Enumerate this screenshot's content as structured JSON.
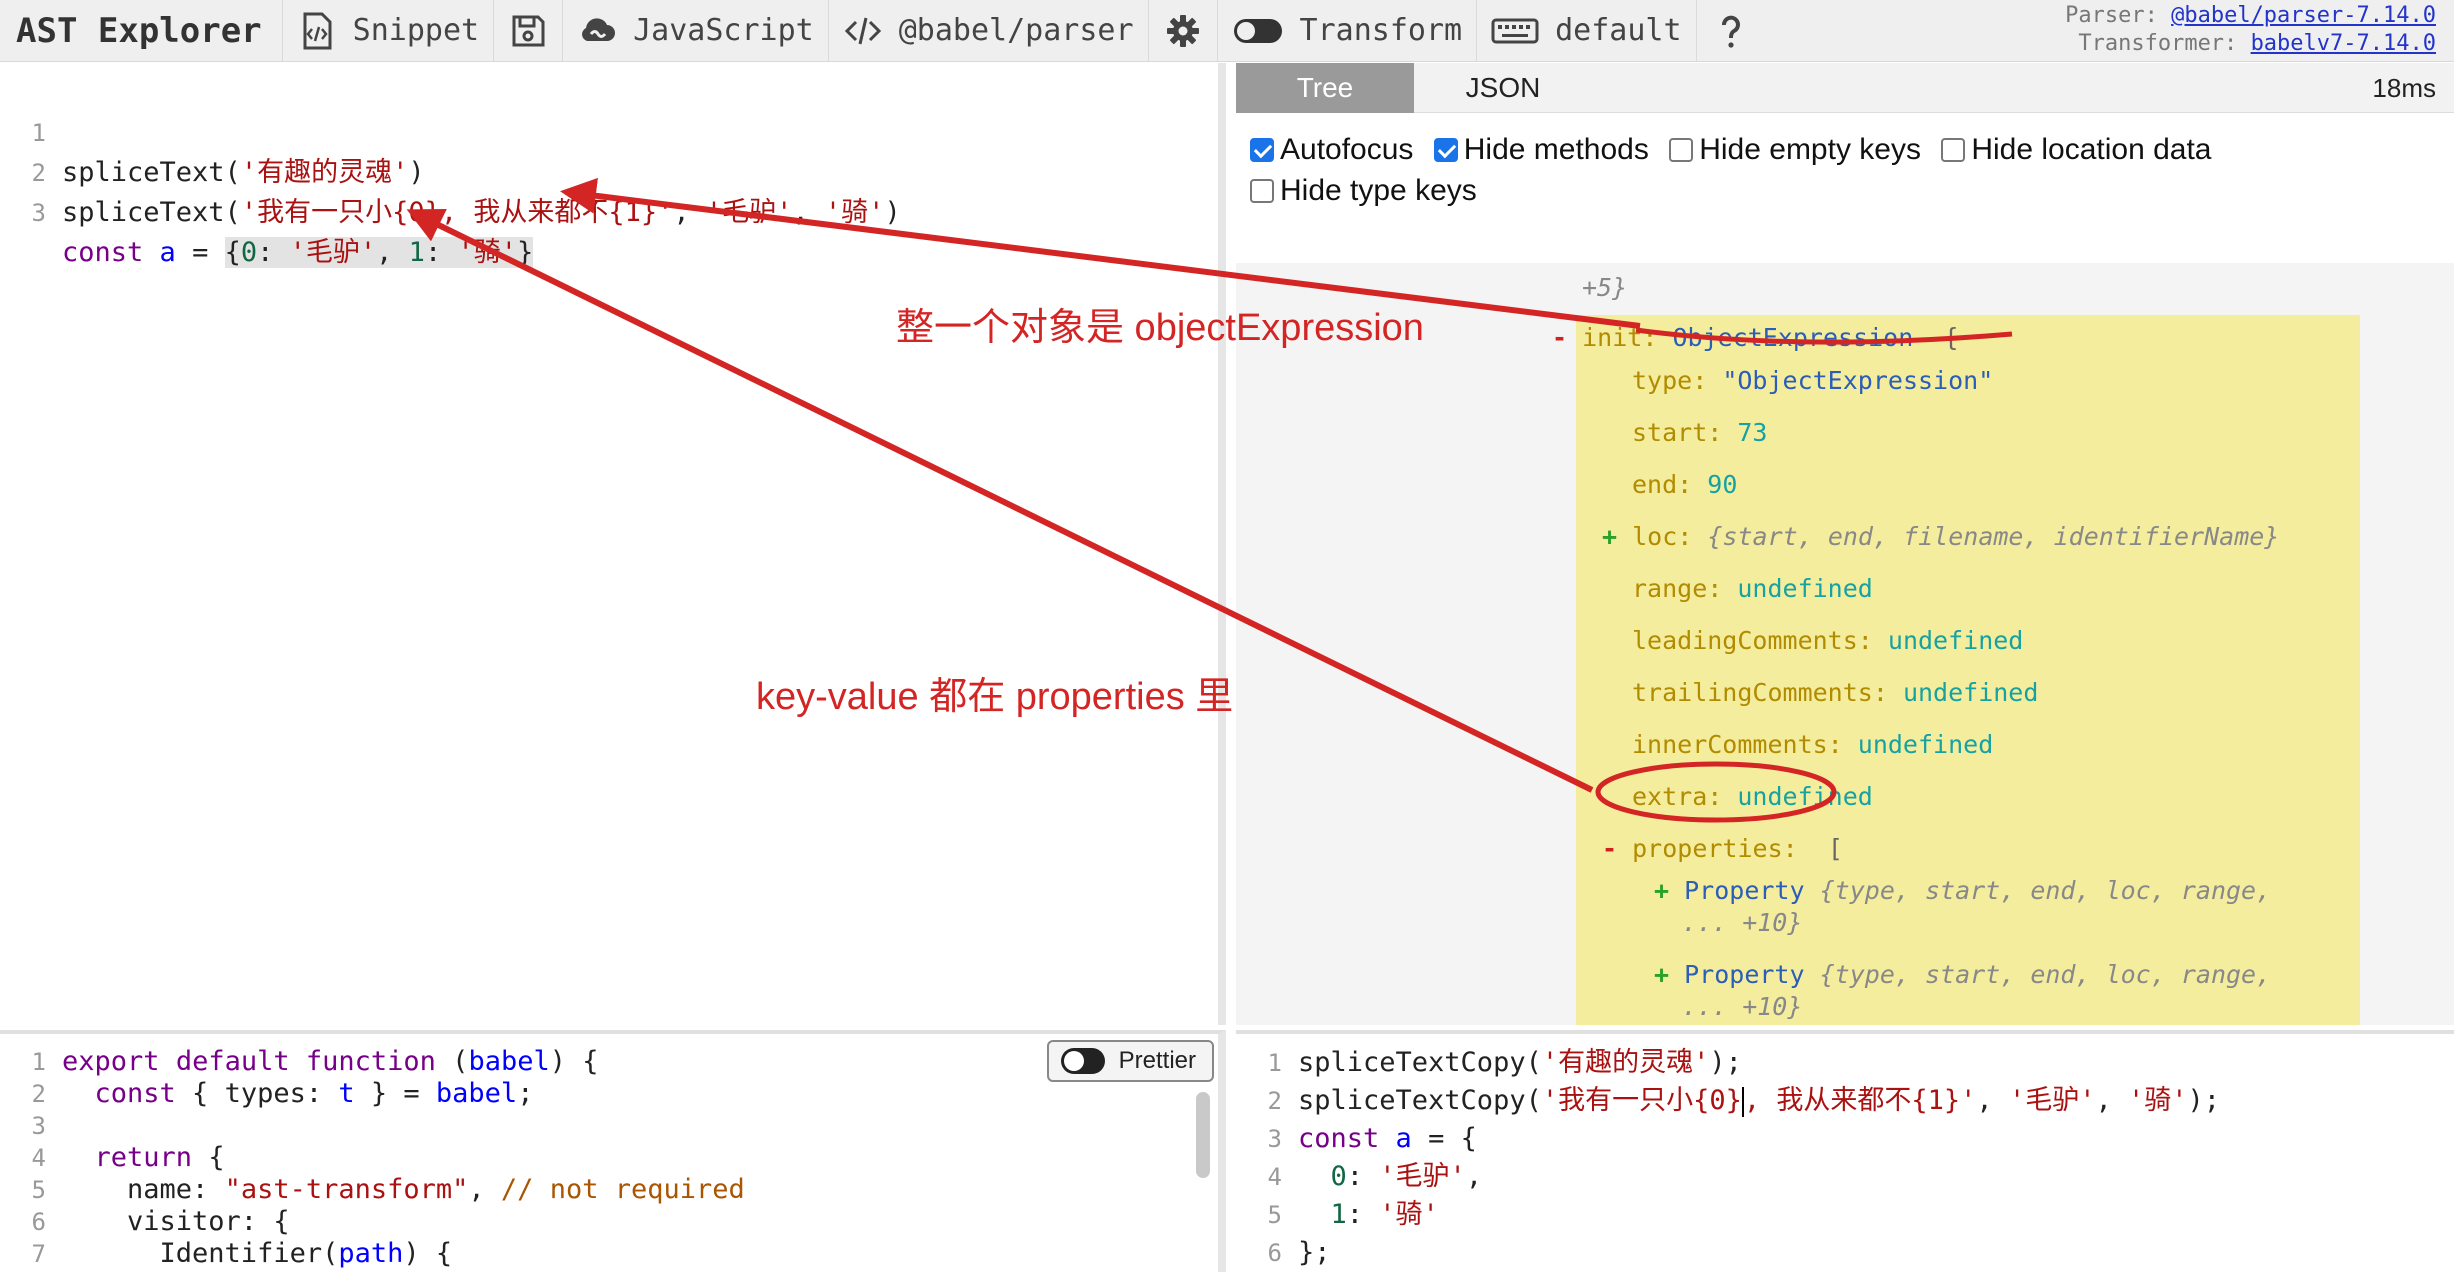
{
  "toolbar": {
    "brand": "AST Explorer",
    "snippet_label": "Snippet",
    "language_label": "JavaScript",
    "parser_label": "@babel/parser",
    "transform_label": "Transform",
    "keymap_label": "default",
    "parser_meta_label": "Parser:",
    "parser_meta_link": "@babel/parser-7.14.0",
    "transformer_meta_label": "Transformer:",
    "transformer_meta_link": "babelv7-7.14.0"
  },
  "editor": {
    "lines": [
      {
        "n": "1",
        "text": "spliceText('有趣的灵魂')"
      },
      {
        "n": "2",
        "text": "spliceText('我有一只小{0}, 我从来都不{1}', '毛驴', '骑')"
      },
      {
        "n": "3",
        "text": "const a = {0: '毛驴', 1: '骑'}"
      }
    ]
  },
  "ast": {
    "tabs": [
      "Tree",
      "JSON"
    ],
    "time": "18ms",
    "options": [
      {
        "label": "Autofocus",
        "checked": true
      },
      {
        "label": "Hide methods",
        "checked": true
      },
      {
        "label": "Hide empty keys",
        "checked": false
      },
      {
        "label": "Hide location data",
        "checked": false
      },
      {
        "label": "Hide type keys",
        "checked": false
      }
    ],
    "tree": {
      "more": "+5}",
      "init_key": "init:",
      "init_type": "ObjectExpression",
      "init_brace": "{",
      "type_key": "type:",
      "type_val": "\"ObjectExpression\"",
      "start_key": "start:",
      "start_val": "73",
      "end_key": "end:",
      "end_val": "90",
      "loc_key": "loc:",
      "loc_summary": "{start, end, filename, identifierName}",
      "range_key": "range:",
      "range_val": "undefined",
      "leading_key": "leadingComments:",
      "leading_val": "undefined",
      "trailing_key": "trailingComments:",
      "trailing_val": "undefined",
      "inner_key": "innerComments:",
      "inner_val": "undefined",
      "extra_key": "extra:",
      "extra_val": "undefined",
      "properties_key": "properties:",
      "properties_open": "[",
      "prop1_type": "Property",
      "prop1_summary_a": "{type, start, end, loc, range,",
      "prop1_summary_b": "... +10}",
      "prop2_type": "Property",
      "prop2_summary_a": "{type, start, end, loc, range,",
      "prop2_summary_b": "... +10}",
      "properties_close": "]",
      "minus": "-",
      "plus": "+"
    }
  },
  "transform_editor": {
    "prettier_label": "Prettier",
    "lines": [
      {
        "n": "1",
        "text": "export default function (babel) {"
      },
      {
        "n": "2",
        "text": "  const { types: t } = babel;"
      },
      {
        "n": "3",
        "text": ""
      },
      {
        "n": "4",
        "text": "  return {"
      },
      {
        "n": "5",
        "text": "    name: \"ast-transform\", // not required"
      },
      {
        "n": "6",
        "text": "    visitor: {"
      },
      {
        "n": "7",
        "text": "      Identifier(path) {"
      }
    ]
  },
  "output": {
    "lines": [
      {
        "n": "1",
        "text": "spliceTextCopy('有趣的灵魂');"
      },
      {
        "n": "2",
        "text": "spliceTextCopy('我有一只小{0}, 我从来都不{1}', '毛驴', '骑');"
      },
      {
        "n": "3",
        "text": "const a = {"
      },
      {
        "n": "4",
        "text": "  0: '毛驴',"
      },
      {
        "n": "5",
        "text": "  1: '骑'"
      },
      {
        "n": "6",
        "text": "};"
      }
    ]
  },
  "annotations": {
    "note_object": "整一个对象是 objectExpression",
    "note_properties": "key-value 都在 properties 里",
    "color": "#d42525"
  }
}
